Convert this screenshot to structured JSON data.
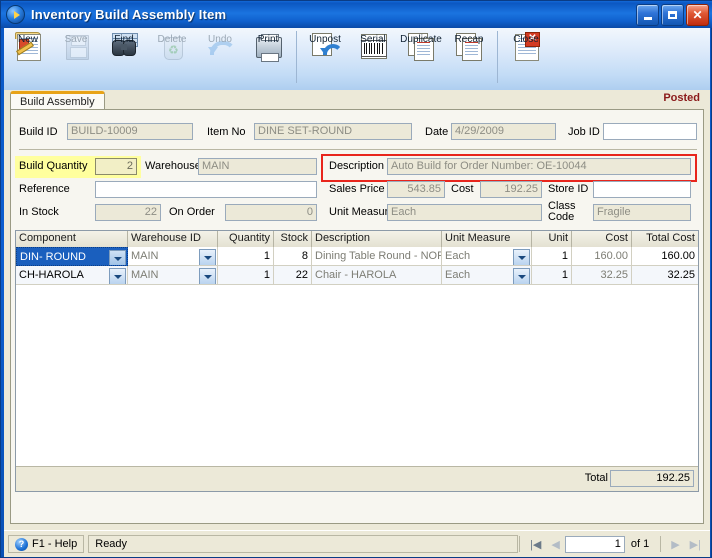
{
  "window": {
    "title": "Inventory Build Assembly Item",
    "icon": "play-circle-icon",
    "controls": {
      "minimize": "_",
      "maximize": "□",
      "close": "✕"
    }
  },
  "toolbar": {
    "buttons": [
      {
        "label": "New",
        "icon": "new-document-icon",
        "enabled": true
      },
      {
        "label": "Save",
        "icon": "floppy-disk-icon",
        "enabled": false
      },
      {
        "label": "Find",
        "icon": "binoculars-icon",
        "enabled": true
      },
      {
        "label": "Delete",
        "icon": "trash-bin-icon",
        "enabled": false
      },
      {
        "label": "Undo",
        "icon": "undo-arrow-icon",
        "enabled": false
      },
      {
        "label": "Print",
        "icon": "printer-icon",
        "enabled": true
      },
      {
        "label": "Unpost",
        "icon": "unpost-icon",
        "enabled": true
      },
      {
        "label": "Serial",
        "icon": "barcode-icon",
        "enabled": true
      },
      {
        "label": "Duplicate",
        "icon": "duplicate-pages-icon",
        "enabled": true
      },
      {
        "label": "Recap",
        "icon": "recap-document-icon",
        "enabled": true
      },
      {
        "label": "Close",
        "icon": "close-document-icon",
        "enabled": true
      }
    ]
  },
  "tabs": [
    {
      "label": "Build Assembly",
      "active": true
    }
  ],
  "status_label": "Posted",
  "form": {
    "build_id": {
      "label": "Build ID",
      "value": "BUILD-10009"
    },
    "item_no": {
      "label": "Item No",
      "value": "DINE SET-ROUND"
    },
    "date": {
      "label": "Date",
      "value": "4/29/2009"
    },
    "job_id": {
      "label": "Job ID",
      "value": ""
    },
    "build_qty": {
      "label": "Build Quantity",
      "value": "2",
      "highlighted": true
    },
    "warehouse": {
      "label": "Warehouse",
      "value": "MAIN"
    },
    "description": {
      "label": "Description",
      "value": "Auto Build for Order Number: OE-10044",
      "outlined": true
    },
    "reference": {
      "label": "Reference",
      "value": ""
    },
    "sales_price": {
      "label": "Sales Price",
      "value": "543.85"
    },
    "cost": {
      "label": "Cost",
      "value": "192.25"
    },
    "store_id": {
      "label": "Store ID",
      "value": ""
    },
    "in_stock": {
      "label": "In Stock",
      "value": "22"
    },
    "on_order": {
      "label": "On Order",
      "value": "0"
    },
    "unit_measure": {
      "label": "Unit Measure",
      "value": "Each"
    },
    "class_code": {
      "label": "Class\nCode",
      "label1": "Class",
      "label2": "Code",
      "value": "Fragile"
    }
  },
  "grid": {
    "columns": [
      "Component",
      "Warehouse ID",
      "Quantity",
      "Stock",
      "Description",
      "Unit Measure",
      "Unit",
      "Cost",
      "Total Cost"
    ],
    "rows": [
      {
        "component": "DIN- ROUND",
        "warehouse_id": "MAIN",
        "quantity": "1",
        "stock": "8",
        "description": "Dining Table Round - NORD",
        "unit_measure": "Each",
        "unit": "1",
        "cost": "160.00",
        "total_cost": "160.00",
        "selected": true
      },
      {
        "component": "CH-HAROLA",
        "warehouse_id": "MAIN",
        "quantity": "1",
        "stock": "22",
        "description": "Chair - HAROLA",
        "unit_measure": "Each",
        "unit": "1",
        "cost": "32.25",
        "total_cost": "32.25",
        "selected": false
      }
    ],
    "footer": {
      "total_label": "Total",
      "total_value": "192.25"
    }
  },
  "statusbar": {
    "help": "F1 - Help",
    "help_icon": "question-circle-icon",
    "state": "Ready",
    "nav": {
      "first": "|◀",
      "prev": "◀",
      "next": "▶",
      "last": "▶|",
      "page": "1",
      "of_label": "of",
      "page_count": "1"
    }
  },
  "colors": {
    "title_blue": "#0b57c2",
    "highlight_yellow": "#ffff9e",
    "outline_red": "#e8251c",
    "posted_maroon": "#8b1a1a",
    "selection_blue": "#1a5fbe",
    "client_bg": "#ece9d8"
  }
}
